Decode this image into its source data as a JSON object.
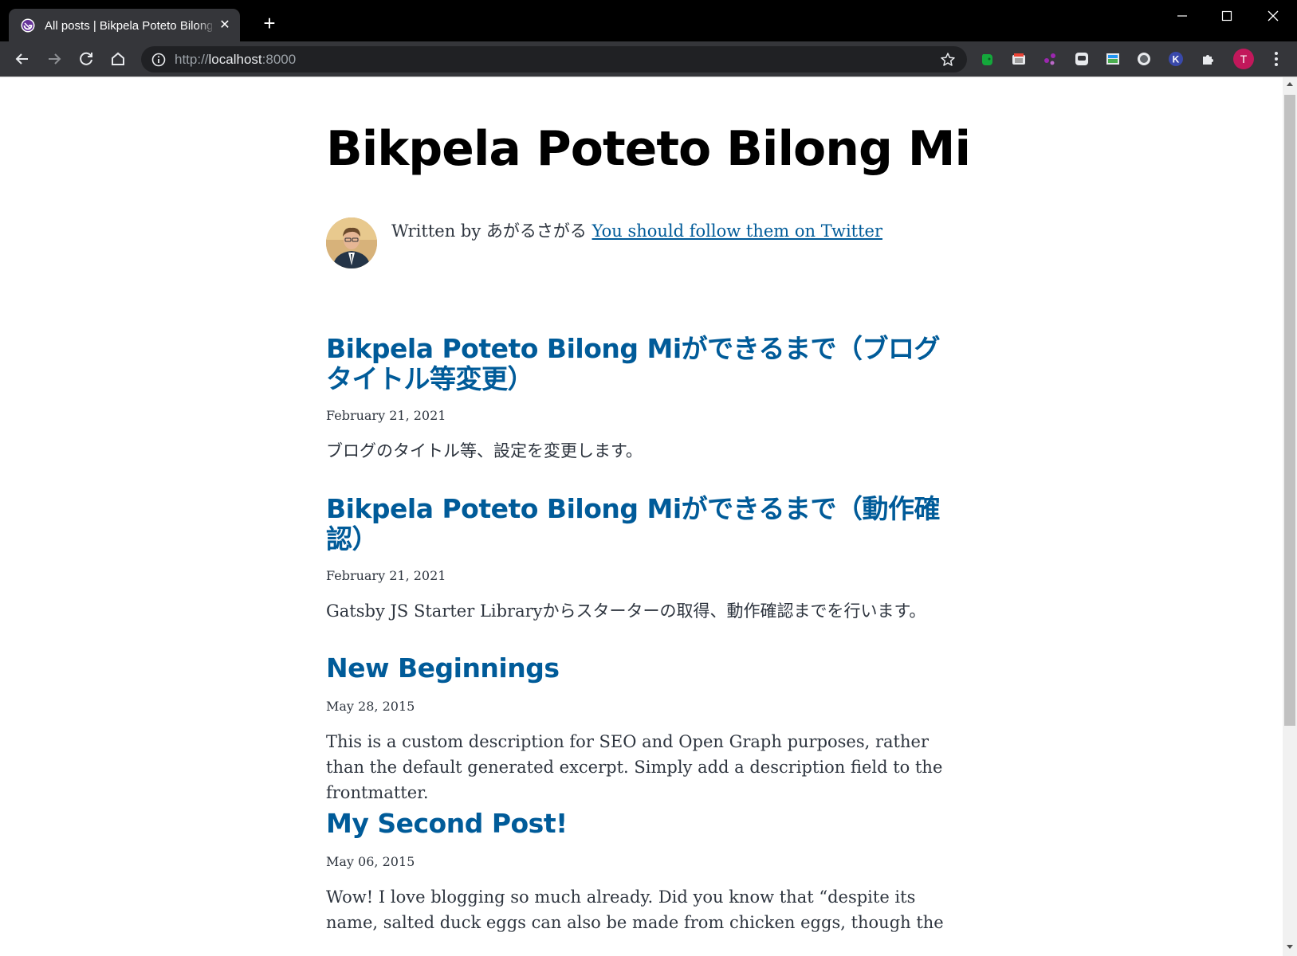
{
  "browser": {
    "tab_title": "All posts | Bikpela Poteto Bilong Mi",
    "url_scheme": "http://",
    "url_host": "localhost",
    "url_port": ":8000",
    "profile_initial": "T"
  },
  "site": {
    "title": "Bikpela Poteto Bilong Mi",
    "bio_prefix": "Written by あがるさがる ",
    "bio_link": "You should follow them on Twitter"
  },
  "posts": [
    {
      "title": "Bikpela Poteto Bilong Miができるまで（ブログタイトル等変更）",
      "date": "February 21, 2021",
      "description": "ブログのタイトル等、設定を変更します。"
    },
    {
      "title": "Bikpela Poteto Bilong Miができるまで（動作確認）",
      "date": "February 21, 2021",
      "description": "Gatsby JS Starter Libraryからスターターの取得、動作確認までを行います。"
    },
    {
      "title": "New Beginnings",
      "date": "May 28, 2015",
      "description": "This is a custom description for SEO and Open Graph purposes, rather than the default generated excerpt. Simply add a description field to the frontmatter."
    },
    {
      "title": "My Second Post!",
      "date": "May 06, 2015",
      "description": "Wow! I love blogging so much already. Did you know that “despite its name, salted duck eggs can also be made from chicken eggs, though the"
    }
  ],
  "colors": {
    "link": "#005b99",
    "text": "#2e353f",
    "chrome_dark": "#35363a",
    "profile": "#c2185b"
  },
  "icons": {
    "extensions": [
      "evernote-icon",
      "chrome-cast-icon",
      "dots-extension-icon",
      "chat-extension-icon",
      "image-extension-icon",
      "circle-extension-icon",
      "k-extension-icon",
      "puzzle-extensions-icon"
    ]
  }
}
